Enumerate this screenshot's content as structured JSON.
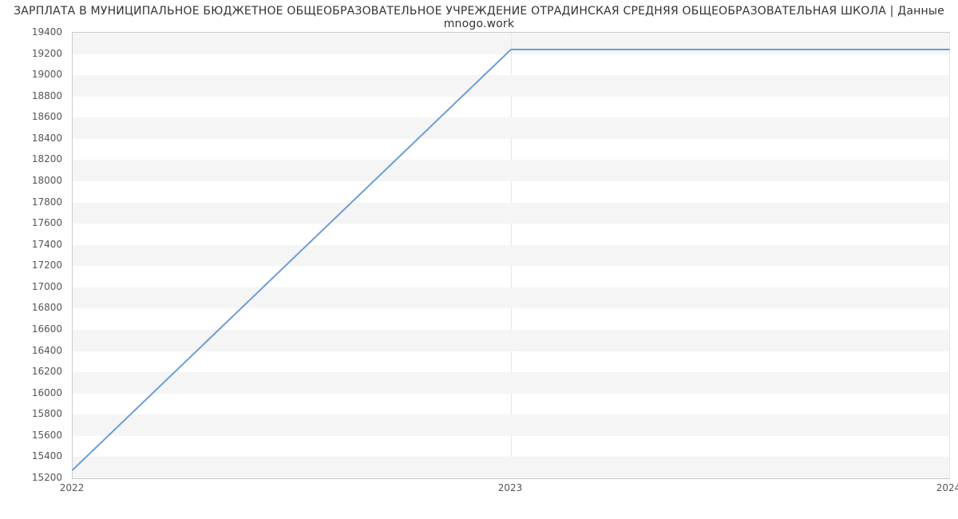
{
  "chart_data": {
    "type": "line",
    "title": "ЗАРПЛАТА В МУНИЦИПАЛЬНОЕ БЮДЖЕТНОЕ ОБЩЕОБРАЗОВАТЕЛЬНОЕ УЧРЕЖДЕНИЕ ОТРАДИНСКАЯ СРЕДНЯЯ ОБЩЕОБРАЗОВАТЕЛЬНАЯ ШКОЛА | Данные mnogo.work",
    "x": [
      2022,
      2023,
      2024
    ],
    "values": [
      15279,
      19242,
      19242
    ],
    "xlabel": "",
    "ylabel": "",
    "xlim": [
      2022,
      2024
    ],
    "ylim": [
      15200,
      19400
    ],
    "x_ticks": [
      2022,
      2023,
      2024
    ],
    "y_ticks": [
      15200,
      15400,
      15600,
      15800,
      16000,
      16200,
      16400,
      16600,
      16800,
      17000,
      17200,
      17400,
      17600,
      17800,
      18000,
      18200,
      18400,
      18600,
      18800,
      19000,
      19200,
      19400
    ],
    "series_color": "#6a9ed6",
    "grid": true
  }
}
